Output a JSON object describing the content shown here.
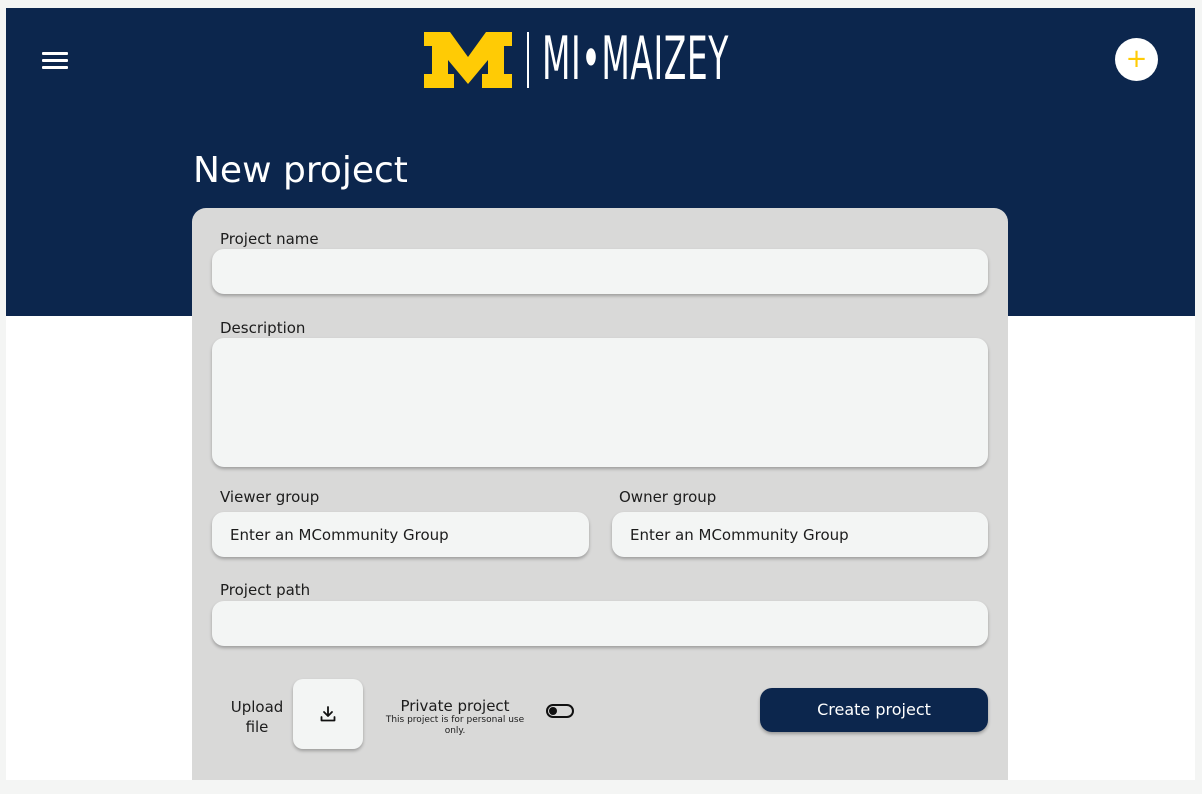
{
  "header": {
    "brand_text": "MI•MAIZEY",
    "logo_letter": "M",
    "add_label": "+",
    "colors": {
      "navy": "#0c264d",
      "maize": "#ffcb05"
    }
  },
  "icons": {
    "menu": "hamburger-menu-icon",
    "add": "plus-icon",
    "upload": "download-arrow-icon"
  },
  "page": {
    "title": "New project"
  },
  "form": {
    "project_name": {
      "label": "Project name",
      "value": "",
      "placeholder": ""
    },
    "description": {
      "label": "Description",
      "value": "",
      "placeholder": ""
    },
    "viewer_group": {
      "label": "Viewer group",
      "placeholder": "Enter an MCommunity Group"
    },
    "owner_group": {
      "label": "Owner group",
      "placeholder": "Enter an MCommunity Group"
    },
    "project_path": {
      "label": "Project path",
      "value": "",
      "placeholder": ""
    },
    "upload": {
      "label": "Upload file"
    },
    "private": {
      "title": "Private project",
      "subtitle": "This project is for personal use only.",
      "enabled": false
    },
    "create_label": "Create project"
  }
}
